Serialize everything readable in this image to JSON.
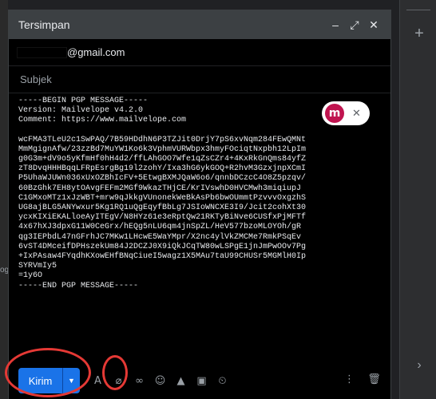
{
  "compose": {
    "title": "Tersimpan",
    "to_suffix": "@gmail.com",
    "subject_placeholder": "Subjek",
    "body_lines_top": [
      "-----BEGIN PGP MESSAGE-----",
      "Version: Mailvelope v4.2.0",
      "Comment: https://www.mailvelope.com"
    ],
    "body_lines_data": [
      "wcFMA3TLeU2c1SwPAQ/7B59HDdhN6P3TZJit0DrjY7pS6xvNqm284FEwQMNt",
      "MmMgignAfw/23zzBd7MuYW1Ko6k3VphmVURWbpx3hmyFOciqtNxpbh12LpIm",
      "g0G3m+dV9o5yKfmHf0hH4d2/ffLAhGOO7Wfe1qZsCZr4+4KxRkGnQms84yfZ",
      "zT8DvqHHHBqqLFRpEsrgBg19l2zohY/Ixa3hG6ykGOQ+R2hvM3GzxjnpXCmI",
      "P5UhaWJUWn036xUxOZBhIcFV+5EtwgBXMJQaW6o6/qnnbDCzcC4O8Z5pzqv/",
      "60BzGhk7EH8ytOAvgFEFm2MGf9WkazTHjCE/KrIVswhD0HVCMwh3miqiupJ",
      "C1GMxoMTz1xJzWBT+mrw9qJkkgVUnonekWeBkAsPb6bwOUmmtPzvvvOxgzhS",
      "UG8ajBLG5ANYwxur5Kg1RQ1uQgEqyfBbLg7JSIoWNCXE3I9/Jcit2cohXt30",
      "ycxKIXiEKALloeAyITEgV/N8HYz61e3eRptQw21RKTyBiNve6CUSfxPjMFTf",
      "4x67hXJ3dpxG11W0CeGrx/hEQg5nLU6qm4jnSpZL/HeV577bzoMLOYOh/gR",
      "qg3IEPbdL47nGFrhJC7MKw1LHcwE5WaYMpr/X2nc4ylVkZMCMe7RmkPSqEv",
      "6vST4DMceifDPHszekUm84J2DCZJ0X9iQkJCqTW80wLSPgE1jnJmPwOOv7Pg",
      "+IxPAsaw4FYqdhKXowEHfBNqCiueI5wagz1X5MAu7taU99CHUSr5MGMlH0Ip",
      "SYRVmIy5"
    ],
    "body_lines_end": [
      "=1y6O",
      "-----END PGP MESSAGE-----"
    ],
    "send_label": "Kirim"
  },
  "left_hint": "og",
  "colors": {
    "send": "#1a73e8",
    "ring": "#e53935",
    "mailvelope": "#c0144f"
  },
  "icons": [
    "minimize-icon",
    "expand-icon",
    "close-icon",
    "format-text-icon",
    "attach-icon",
    "link-icon",
    "emoji-icon",
    "drive-icon",
    "photo-icon",
    "confidential-icon",
    "more-options-icon",
    "delete-icon"
  ]
}
